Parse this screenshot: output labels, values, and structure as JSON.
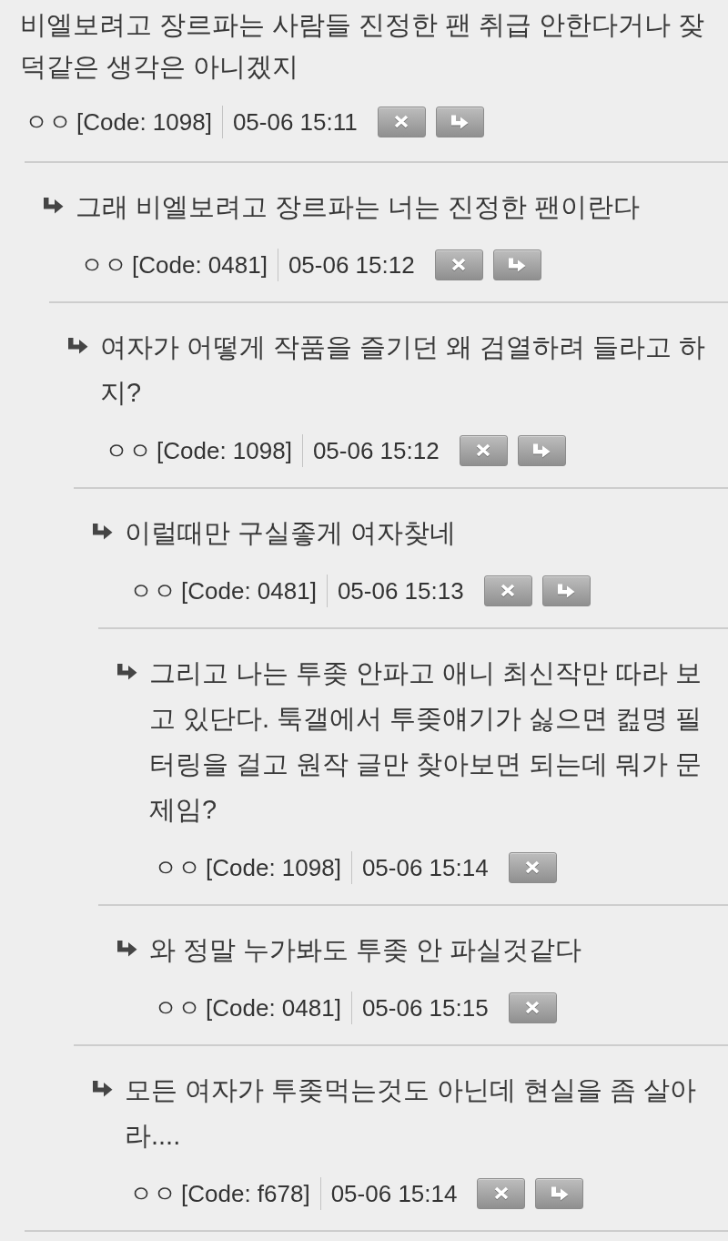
{
  "comments": [
    {
      "text": "비엘보려고 장르파는 사람들 진정한 팬 취급 안한다거나 잦덕같은 생각은 아니겠지",
      "author": "ㅇㅇ",
      "code": "[Code: 1098]",
      "date": "05-06 15:11",
      "buttons": [
        {
          "kind": "delete"
        },
        {
          "kind": "reply"
        }
      ],
      "children": [
        {
          "text": "그래 비엘보려고 장르파는 너는 진정한 팬이란다",
          "author": "ㅇㅇ",
          "code": "[Code: 0481]",
          "date": "05-06 15:12",
          "buttons": [
            {
              "kind": "delete"
            },
            {
              "kind": "reply"
            }
          ],
          "children": [
            {
              "text": "여자가 어떻게 작품을 즐기던 왜 검열하려 들라고 하지?",
              "author": "ㅇㅇ",
              "code": "[Code: 1098]",
              "date": "05-06 15:12",
              "buttons": [
                {
                  "kind": "delete"
                },
                {
                  "kind": "reply"
                }
              ],
              "children": [
                {
                  "text": "이럴때만 구실좋게 여자찾네",
                  "author": "ㅇㅇ",
                  "code": "[Code: 0481]",
                  "date": "05-06 15:13",
                  "buttons": [
                    {
                      "kind": "delete"
                    },
                    {
                      "kind": "reply"
                    }
                  ],
                  "children": [
                    {
                      "text": "그리고 나는 투좆 안파고 애니 최신작만 따라 보고 있단다. 툭갤에서 투좆얘기가 싫으면 컲명 필터링을 걸고 원작 글만 찾아보면 되는데 뭐가 문제임?",
                      "author": "ㅇㅇ",
                      "code": "[Code: 1098]",
                      "date": "05-06 15:14",
                      "buttons": [
                        {
                          "kind": "delete"
                        }
                      ]
                    },
                    {
                      "text": "와 정말 누가봐도 투좆 안 파실것같다",
                      "author": "ㅇㅇ",
                      "code": "[Code: 0481]",
                      "date": "05-06 15:15",
                      "buttons": [
                        {
                          "kind": "delete"
                        }
                      ]
                    }
                  ]
                },
                {
                  "text": "모든 여자가 투좆먹는것도 아닌데 현실을 좀 살아라....",
                  "author": "ㅇㅇ",
                  "code": "[Code: f678]",
                  "date": "05-06 15:14",
                  "buttons": [
                    {
                      "kind": "delete"
                    },
                    {
                      "kind": "reply"
                    }
                  ]
                }
              ]
            }
          ]
        }
      ]
    }
  ]
}
